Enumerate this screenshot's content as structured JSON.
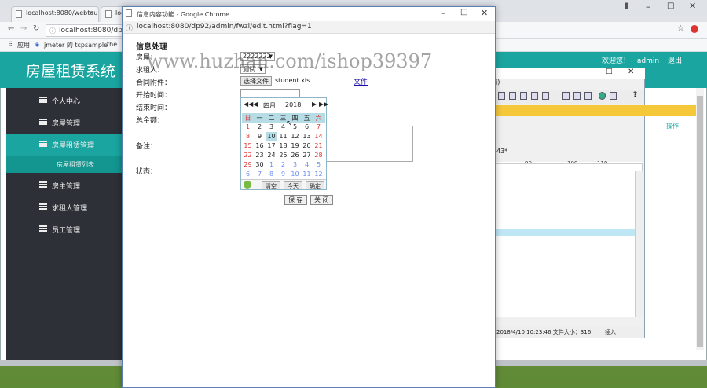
{
  "back_browser": {
    "tabs": [
      "localhost:8080/webtou",
      "loc"
    ],
    "url": "localhost:8080/dp92",
    "bookmarks": [
      "应用",
      "jmeter 的 tcpsample",
      "the"
    ]
  },
  "app": {
    "title": "房屋租赁系统",
    "welcome": "欢迎您！",
    "user": "admin",
    "logout": "退出",
    "sidebar": [
      {
        "label": "个人中心"
      },
      {
        "label": "房屋管理"
      },
      {
        "label": "房屋租赁管理"
      },
      {
        "label": "房屋租赁列表"
      },
      {
        "label": "房主管理"
      },
      {
        "label": "求租人管理"
      },
      {
        "label": "员工管理"
      }
    ],
    "ops_header": "操作"
  },
  "editor": {
    "title_fragment": "j)",
    "tab_fragment": "43*",
    "ruler": [
      "90",
      "100",
      "110"
    ],
    "status": "2018/4/10 10:23:46  文件大小：316",
    "status_mode": "插入"
  },
  "popup": {
    "window_title": "信息内容功能 - Google Chrome",
    "url": "localhost:8080/dp92/admin/fwzl/edit.html?flag=1",
    "form_title": "信息处理",
    "labels": {
      "house": "房屋：",
      "tenant": "求租人：",
      "contract": "合同附件：",
      "start": "开始时间：",
      "end": "结束时间：",
      "total": "总金额：",
      "remark": "备注：",
      "status": "状态："
    },
    "house_value": "2222222",
    "tenant_value": "测试",
    "file_button": "选择文件",
    "file_name": "student.xls",
    "file_link": "文件",
    "save": "保 存",
    "close": "关 闭"
  },
  "calendar": {
    "month": "四月",
    "year": "2018",
    "weekdays": [
      "日",
      "一",
      "二",
      "三",
      "四",
      "五",
      "六"
    ],
    "weeks": [
      [
        [
          "1",
          "wk"
        ],
        [
          "2",
          ""
        ],
        [
          "3",
          ""
        ],
        [
          "4",
          ""
        ],
        [
          "5",
          ""
        ],
        [
          "6",
          ""
        ],
        [
          "7",
          "wk"
        ]
      ],
      [
        [
          "8",
          "wk"
        ],
        [
          "9",
          ""
        ],
        [
          "10",
          "today"
        ],
        [
          "11",
          ""
        ],
        [
          "12",
          ""
        ],
        [
          "13",
          ""
        ],
        [
          "14",
          "wk"
        ]
      ],
      [
        [
          "15",
          "wk"
        ],
        [
          "16",
          ""
        ],
        [
          "17",
          ""
        ],
        [
          "18",
          ""
        ],
        [
          "19",
          ""
        ],
        [
          "20",
          ""
        ],
        [
          "21",
          "wk"
        ]
      ],
      [
        [
          "22",
          "wk"
        ],
        [
          "23",
          ""
        ],
        [
          "24",
          ""
        ],
        [
          "25",
          ""
        ],
        [
          "26",
          ""
        ],
        [
          "27",
          ""
        ],
        [
          "28",
          "wk"
        ]
      ],
      [
        [
          "29",
          "wk"
        ],
        [
          "30",
          ""
        ],
        [
          "1",
          "oth"
        ],
        [
          "2",
          "oth"
        ],
        [
          "3",
          "oth"
        ],
        [
          "4",
          "oth"
        ],
        [
          "5",
          "oth"
        ]
      ],
      [
        [
          "6",
          "oth"
        ],
        [
          "7",
          "oth"
        ],
        [
          "8",
          "oth"
        ],
        [
          "9",
          "oth"
        ],
        [
          "10",
          "oth"
        ],
        [
          "11",
          "oth"
        ],
        [
          "12",
          "oth"
        ]
      ]
    ],
    "clear": "清空",
    "today": "今天",
    "ok": "确定"
  },
  "watermark": "www.huzhan.com/ishop39397"
}
